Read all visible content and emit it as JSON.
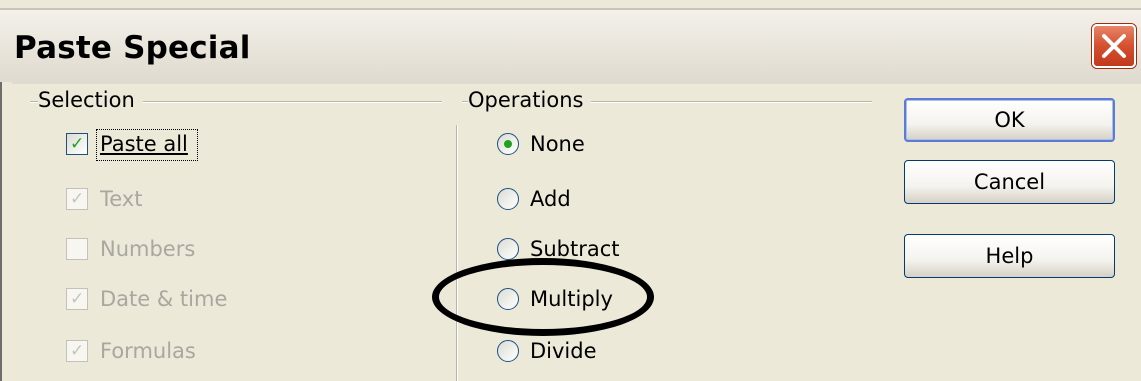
{
  "window": {
    "title": "Paste Special",
    "close_icon": "close-icon"
  },
  "selection": {
    "title": "Selection",
    "items": [
      {
        "label": "Paste all",
        "checked": true,
        "enabled": true
      },
      {
        "label": "Text",
        "checked": true,
        "enabled": false
      },
      {
        "label": "Numbers",
        "checked": false,
        "enabled": false
      },
      {
        "label": "Date & time",
        "checked": true,
        "enabled": false
      },
      {
        "label": "Formulas",
        "checked": true,
        "enabled": false
      }
    ]
  },
  "operations": {
    "title": "Operations",
    "options": [
      {
        "label": "None",
        "selected": true
      },
      {
        "label": "Add",
        "selected": false
      },
      {
        "label": "Subtract",
        "selected": false
      },
      {
        "label": "Multiply",
        "selected": false
      },
      {
        "label": "Divide",
        "selected": false
      }
    ]
  },
  "buttons": {
    "ok": "OK",
    "cancel": "Cancel",
    "help": "Help"
  },
  "colors": {
    "dialog_bg": "#ece9d8",
    "check_green": "#21a121",
    "close_red": "#d4502f",
    "annotation": "#000000"
  }
}
